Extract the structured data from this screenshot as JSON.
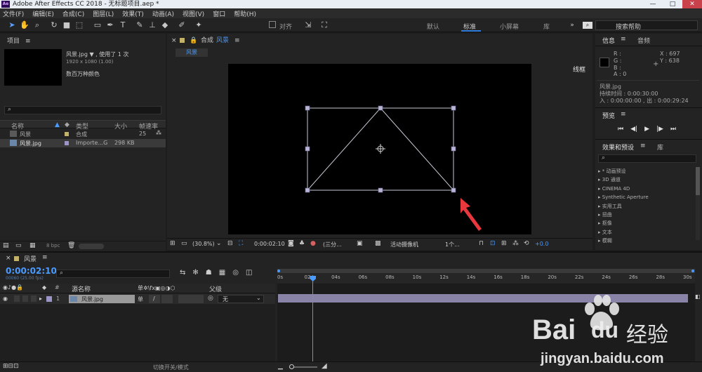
{
  "app": {
    "title": "Adobe After Effects CC 2018 - 无标题项目.aep *",
    "logo": "Ae",
    "controls": [
      "—",
      "□",
      "✕"
    ]
  },
  "menu": [
    "文件(F)",
    "编辑(E)",
    "合成(C)",
    "图层(L)",
    "效果(T)",
    "动画(A)",
    "视图(V)",
    "窗口",
    "帮助(H)"
  ],
  "toolbar": {
    "snap_label": "对齐",
    "workspaces": [
      "默认",
      "标准",
      "小屏幕",
      "库"
    ],
    "active_workspace": "标准",
    "search_placeholder": "搜索帮助"
  },
  "project": {
    "panel_title": "项目",
    "file_name": "风景.jpg ▼ , 使用了 1 次",
    "file_dims": "1920 x 1080 (1.00)",
    "file_colors": "数百万种颜色",
    "columns": [
      "名称",
      "类型",
      "大小",
      "帧速率"
    ],
    "items": [
      {
        "name": "风景",
        "type": "合成",
        "size": "",
        "fps": "25",
        "color": "#c2b26a"
      },
      {
        "name": "风景.jpg",
        "type": "Importe...G",
        "size": "298 KB",
        "fps": "",
        "color": "#9b95c8"
      }
    ],
    "bpc": "8 bpc"
  },
  "composition": {
    "panel_title": "合成",
    "comp_name": "风景",
    "tab_label": "风景",
    "right_label": "线框",
    "zoom": "(30.8%)",
    "time": "0:00:02:10",
    "resolution": "(三分...",
    "camera": "活动摄像机",
    "views": "1个...",
    "exposure": "+0.0"
  },
  "info": {
    "tab_info": "信息",
    "tab_audio": "音频",
    "r": "R :",
    "g": "G :",
    "b": "B :",
    "a": "A : 0",
    "x": "X : 697",
    "y": "Y : 638",
    "file_name": "风景.jpg",
    "duration": "持续时间 : 0:00:30:00",
    "in_out": "入 : 0:00:00:00 , 出 : 0:00:29:24"
  },
  "preview": {
    "title": "预览"
  },
  "effects": {
    "tab_effects": "效果和预设",
    "tab_library": "库",
    "items": [
      "* 动画预设",
      "3D 通道",
      "CINEMA 4D",
      "Synthetic Aperture",
      "实用工具",
      "扭曲",
      "抠像",
      "文本",
      "模糊"
    ]
  },
  "timeline": {
    "comp_name": "风景",
    "timecode": "0:00:02:10",
    "frame_info": "00060 (25.00 fps)",
    "col_source": "源名称",
    "col_parent": "父级",
    "col_num": "#",
    "layer_num": "1",
    "layer_name": "风景.jpg",
    "parent_value": "无",
    "ruler_labels": [
      "0s",
      "02",
      "04s",
      "06s",
      "08s",
      "10s",
      "12s",
      "14s",
      "16s",
      "18s",
      "20s",
      "22s",
      "24s",
      "26s",
      "28s",
      "30s"
    ],
    "playhead_seconds": 2.4,
    "duration_seconds": 30,
    "bottom_label": "切换开关/模式"
  },
  "watermark": {
    "brand": "Bai",
    "brand_suffix": "du",
    "cn": "经验",
    "url": "jingyan.baidu.com"
  }
}
